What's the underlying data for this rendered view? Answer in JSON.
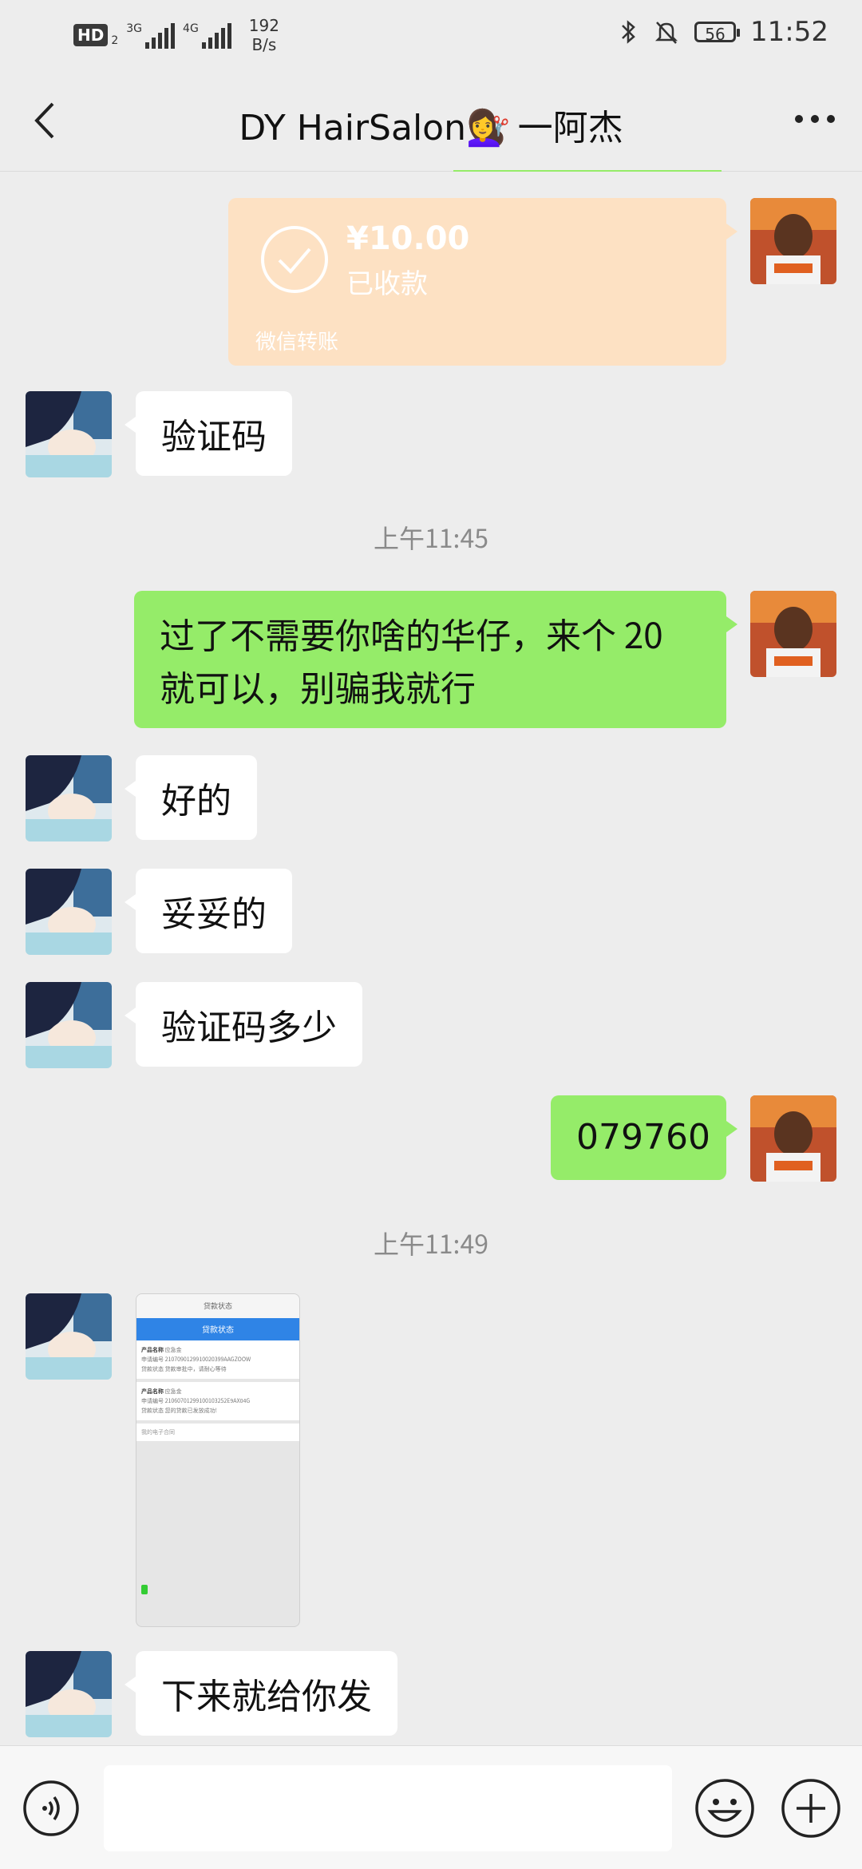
{
  "status_bar": {
    "hd_label": "HD",
    "hd_sub": "2",
    "net1": "3G",
    "net2": "4G",
    "speed_value": "192",
    "speed_unit": "B/s",
    "battery": "56",
    "time": "11:52"
  },
  "header": {
    "title_prefix": "DY HairSalon",
    "title_emoji": "💇‍♀️",
    "title_suffix": " 一阿杰"
  },
  "transfer": {
    "amount": "¥10.00",
    "status": "已收款",
    "footer": "微信转账"
  },
  "messages": {
    "m1": "验证码",
    "ts1": "上午11:45",
    "m2_line1": "过了不需要你啥的华仔，来个 20",
    "m2_line2": "就可以，别骗我就行",
    "m3": "好的",
    "m4": "妥妥的",
    "m5": "验证码多少",
    "m6": "079760",
    "ts2": "上午11:49",
    "m7": "下来就给你发"
  },
  "thumbnail": {
    "top": "贷款状态",
    "bar": "贷款状态",
    "card1_name_label": "产品名称",
    "card1_name": "应急金",
    "card1_no_label": "申请编号",
    "card1_no": "2107090129910020399AAGZOOW",
    "card1_state_label": "贷款状态",
    "card1_state": "贷款审批中，请耐心等待",
    "card2_name_label": "产品名称",
    "card2_name": "应急金",
    "card2_no_label": "申请编号",
    "card2_no": "21060701299100103252E9AX04G",
    "card2_state_label": "贷款状态",
    "card2_state": "您的贷款已发放成功!",
    "link": "我的电子合同"
  },
  "colors": {
    "out_bubble": "#95ec69",
    "in_bubble": "#ffffff",
    "transfer_bg": "#fde1c3",
    "chat_bg": "#ededed"
  }
}
